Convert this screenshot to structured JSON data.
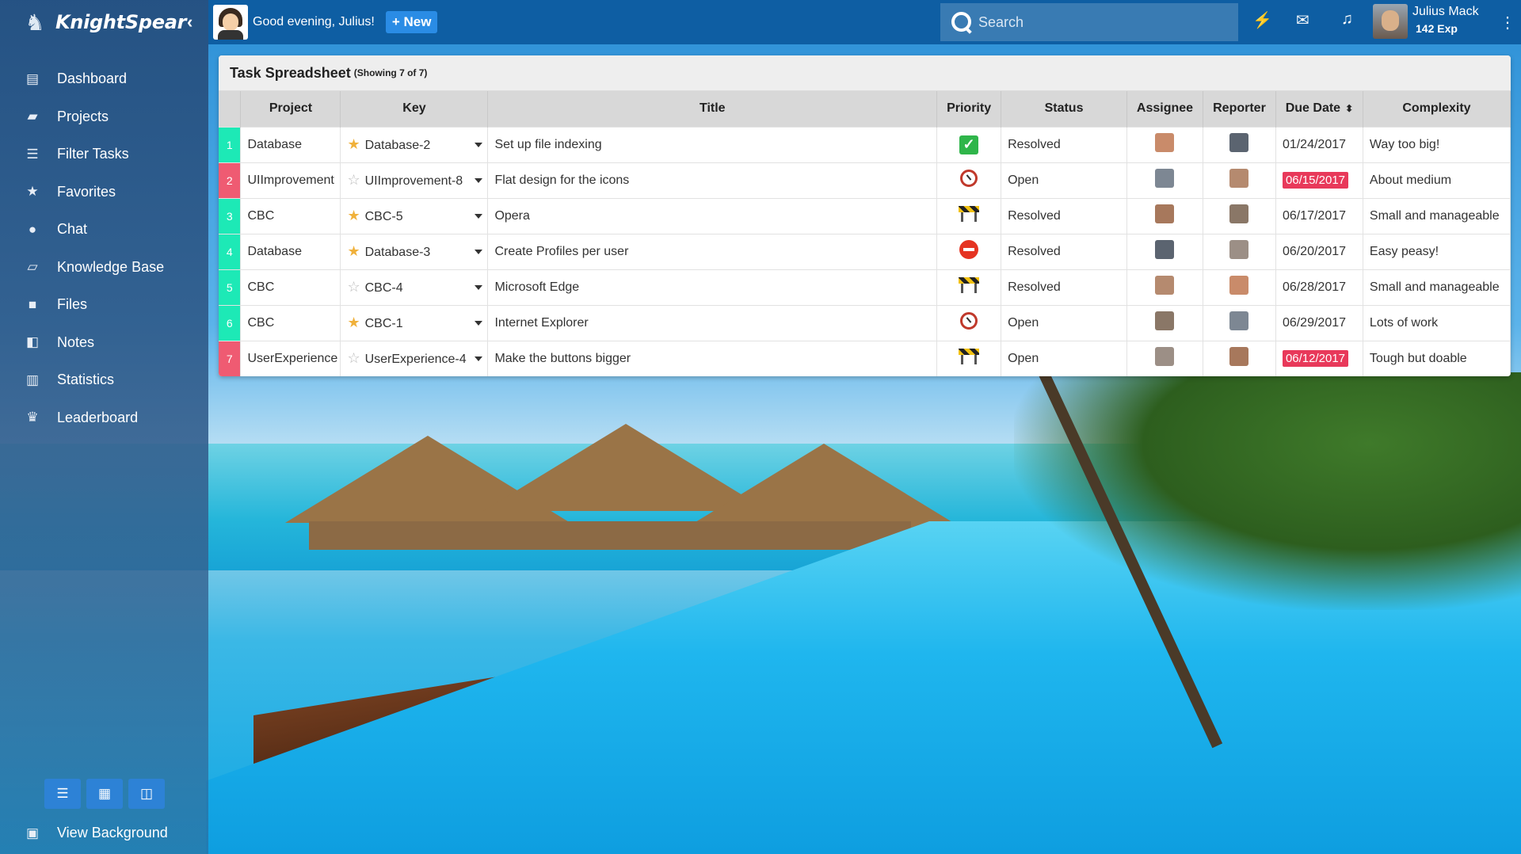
{
  "app": {
    "name": "KnightSpear"
  },
  "topbar": {
    "greeting": "Good evening, Julius!",
    "new_button": "+ New",
    "search_placeholder": "Search",
    "user_name": "Julius Mack",
    "user_exp": "142 Exp"
  },
  "sidebar": {
    "items": [
      {
        "label": "Dashboard",
        "icon": "dashboard-icon"
      },
      {
        "label": "Projects",
        "icon": "folder-icon"
      },
      {
        "label": "Filter Tasks",
        "icon": "filter-icon"
      },
      {
        "label": "Favorites",
        "icon": "star-icon"
      },
      {
        "label": "Chat",
        "icon": "chat-icon"
      },
      {
        "label": "Knowledge Base",
        "icon": "book-icon"
      },
      {
        "label": "Files",
        "icon": "file-icon"
      },
      {
        "label": "Notes",
        "icon": "note-icon"
      },
      {
        "label": "Statistics",
        "icon": "bar-chart-icon"
      },
      {
        "label": "Leaderboard",
        "icon": "trophy-icon"
      }
    ],
    "view_background": "View Background"
  },
  "panel": {
    "title": "Task Spreadsheet",
    "subtitle": "(Showing 7 of 7)",
    "columns": [
      "Project",
      "Key",
      "Title",
      "Priority",
      "Status",
      "Assignee",
      "Reporter",
      "Due Date",
      "Complexity"
    ],
    "rows": [
      {
        "num": "1",
        "num_color": "#1de9b6",
        "project": "Database",
        "key": "Database-2",
        "fav": true,
        "title": "Set up file indexing",
        "priority": "check",
        "status": "Resolved",
        "due": "01/24/2017",
        "due_overdue": false,
        "complexity": "Way too big!"
      },
      {
        "num": "2",
        "num_color": "#ef5b72",
        "project": "UIImprovement",
        "key": "UIImprovement-8",
        "fav": false,
        "title": "Flat design for the icons",
        "priority": "clock",
        "status": "Open",
        "due": "06/15/2017",
        "due_overdue": true,
        "complexity": "About medium"
      },
      {
        "num": "3",
        "num_color": "#1de9b6",
        "project": "CBC",
        "key": "CBC-5",
        "fav": true,
        "title": "Opera",
        "priority": "block",
        "status": "Resolved",
        "due": "06/17/2017",
        "due_overdue": false,
        "complexity": "Small and manageable"
      },
      {
        "num": "4",
        "num_color": "#1de9b6",
        "project": "Database",
        "key": "Database-3",
        "fav": true,
        "title": "Create Profiles per user",
        "priority": "stop",
        "status": "Resolved",
        "due": "06/20/2017",
        "due_overdue": false,
        "complexity": "Easy peasy!"
      },
      {
        "num": "5",
        "num_color": "#1de9b6",
        "project": "CBC",
        "key": "CBC-4",
        "fav": false,
        "title": "Microsoft Edge",
        "priority": "block",
        "status": "Resolved",
        "due": "06/28/2017",
        "due_overdue": false,
        "complexity": "Small and manageable"
      },
      {
        "num": "6",
        "num_color": "#1de9b6",
        "project": "CBC",
        "key": "CBC-1",
        "fav": true,
        "title": "Internet Explorer",
        "priority": "clock",
        "status": "Open",
        "due": "06/29/2017",
        "due_overdue": false,
        "complexity": "Lots of work"
      },
      {
        "num": "7",
        "num_color": "#ef5b72",
        "project": "UserExperience",
        "key": "UserExperience-4",
        "fav": false,
        "title": "Make the buttons bigger",
        "priority": "block",
        "status": "Open",
        "due": "06/12/2017",
        "due_overdue": true,
        "complexity": "Tough but doable"
      }
    ]
  },
  "colors": {
    "topbar": "#0e5ea3",
    "accent": "#2a8ce5",
    "overdue": "#e8395a"
  }
}
